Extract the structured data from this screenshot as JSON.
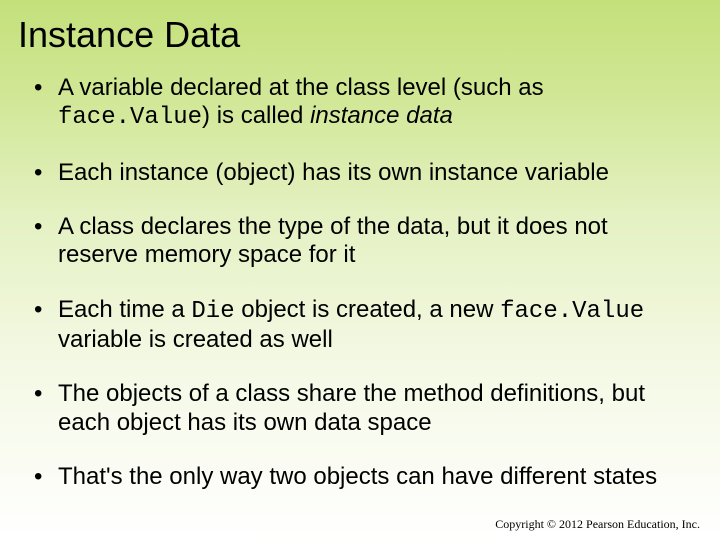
{
  "title": "Instance Data",
  "bullets": {
    "b1a": "A variable declared at the class level (such as ",
    "b1code": "face.Value",
    "b1b": ") is called ",
    "b1ital": "instance data",
    "b2": "Each instance (object) has its own instance variable",
    "b3": "A class declares the type of the data, but it does not reserve memory space for it",
    "b4a": "Each time a ",
    "b4code1": "Die",
    "b4b": " object is created, a new ",
    "b4code2": "face.Value",
    "b4c": " variable is created as well",
    "b5": "The objects of a class share the method definitions, but each object has its own data space",
    "b6": "That's the only way two objects can have different states"
  },
  "footer": "Copyright © 2012 Pearson Education, Inc."
}
